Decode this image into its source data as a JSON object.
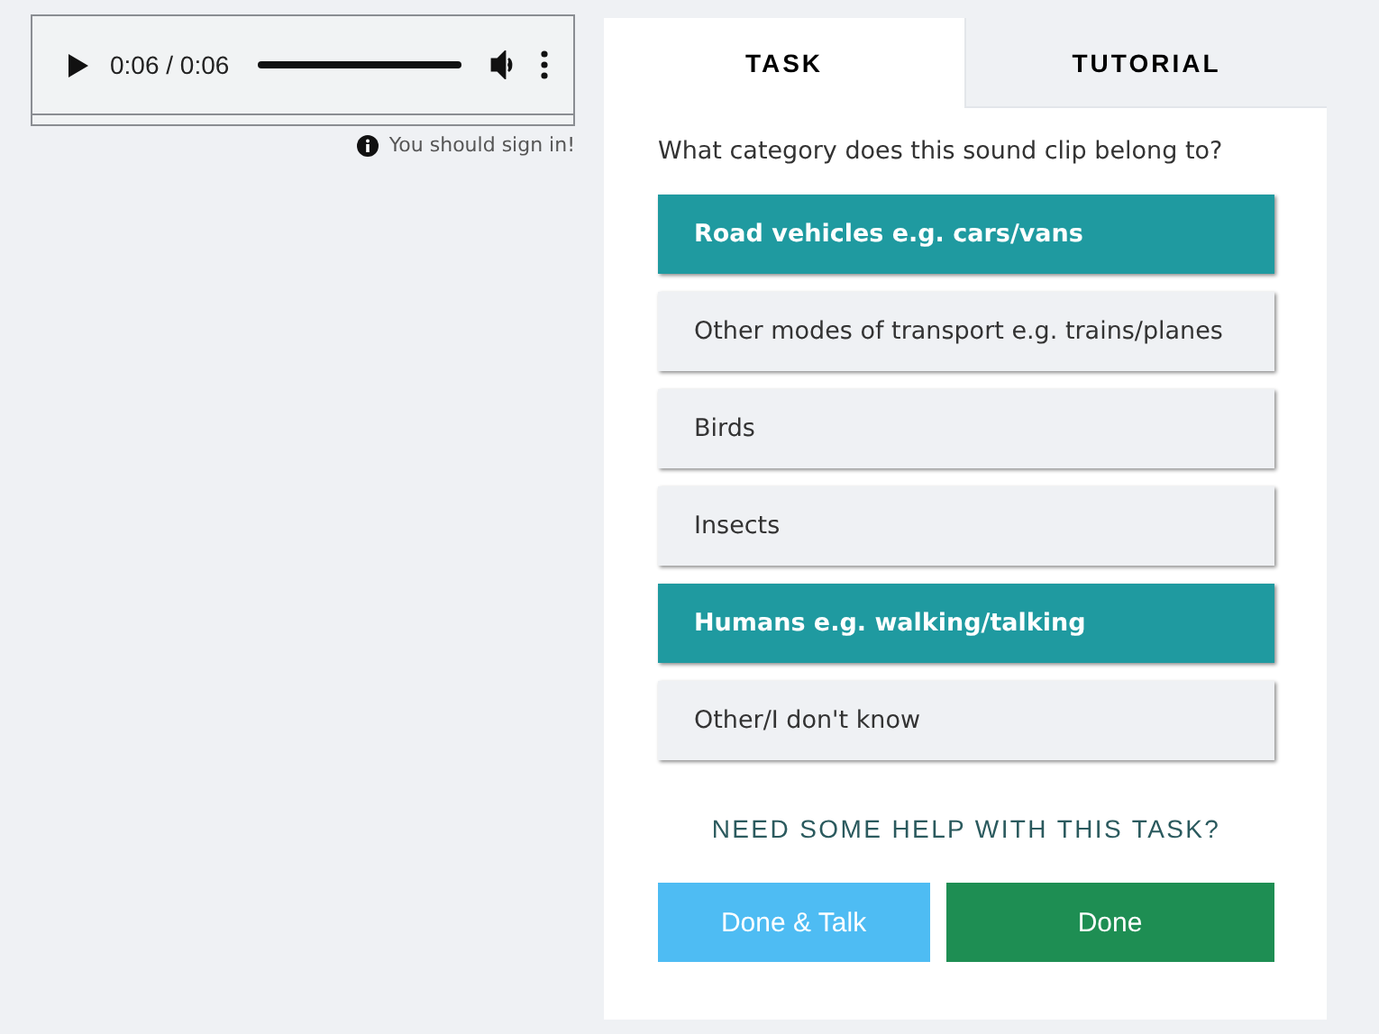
{
  "player": {
    "time": "0:06 / 0:06"
  },
  "notice": {
    "text": "You should sign in!"
  },
  "tabs": [
    {
      "label": "TASK",
      "selected": true
    },
    {
      "label": "TUTORIAL",
      "selected": false
    }
  ],
  "question": "What category does this sound clip belong to?",
  "answers": [
    {
      "label": "Road vehicles e.g. cars/vans",
      "selected": true
    },
    {
      "label": "Other modes of transport e.g. trains/planes",
      "selected": false
    },
    {
      "label": "Birds",
      "selected": false
    },
    {
      "label": "Insects",
      "selected": false
    },
    {
      "label": "Humans e.g. walking/talking",
      "selected": true
    },
    {
      "label": "Other/I don't know",
      "selected": false
    }
  ],
  "help_link": "NEED SOME HELP WITH THIS TASK?",
  "buttons": [
    {
      "label": "Done & Talk",
      "kind": "talk"
    },
    {
      "label": "Done",
      "kind": "done"
    }
  ]
}
